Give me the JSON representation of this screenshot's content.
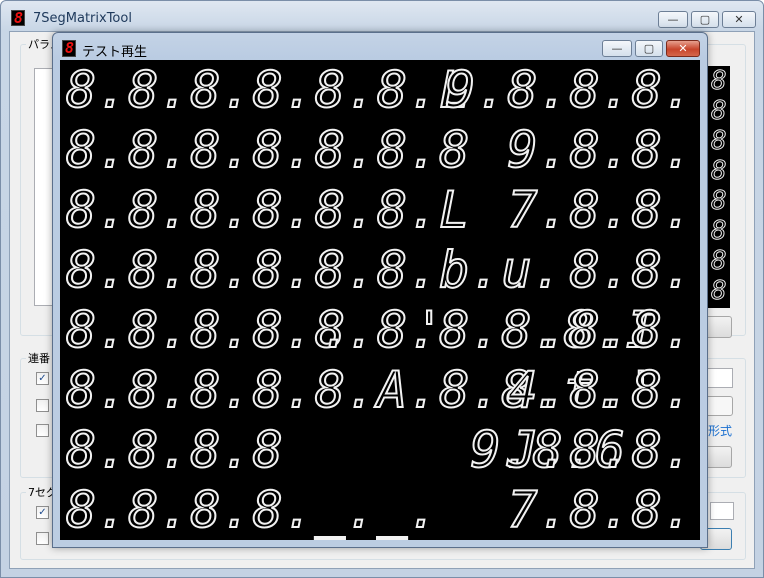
{
  "main_window": {
    "title": "7SegMatrixTool",
    "icon": "seven-segment-app-icon",
    "icon_glyph": "8",
    "param_group_label": "パラメ",
    "serial_group_label": "連番",
    "seg_group_label": "7セグ",
    "format_link_text": "形式",
    "minimize_glyph": "—",
    "maximize_glyph": "▢",
    "close_glyph": "✕"
  },
  "test_window": {
    "title": "テスト再生",
    "icon": "seven-segment-app-icon",
    "icon_glyph": "8",
    "minimize_glyph": "—",
    "maximize_glyph": "▢",
    "close_glyph": "✕"
  },
  "display": {
    "rows": [
      {
        "left": "8.8.8.8.8.8.L",
        "right": "9.8.8.8."
      },
      {
        "left": "8.8.8.8.8.8.8",
        "right": "9.8.8."
      },
      {
        "left": "8.8.8.8.8.8.L",
        "right": "7.8.8."
      },
      {
        "left": "8.8.8.8.8.8.b.u.",
        "right": "8.8."
      },
      {
        "left": "8.8.8.8.8.8.8.8.8.I",
        "right": ".  '   .8.8."
      },
      {
        "left": "8.8.8.8.8.A.8.8.t.'",
        "right": "4.8.8."
      },
      {
        "left": "8.8.8.8      9.8.6",
        "right": "J.8.8."
      },
      {
        "left": "8.8.8.8._._.",
        "right": "7.8.8."
      }
    ],
    "strip_digits": [
      "8",
      "8",
      "8",
      "8",
      "8",
      "8",
      "8",
      "8"
    ]
  },
  "colors": {
    "segment_on": "#f2f2f2",
    "display_bg": "#000000",
    "icon_segment": "#ee1111"
  }
}
